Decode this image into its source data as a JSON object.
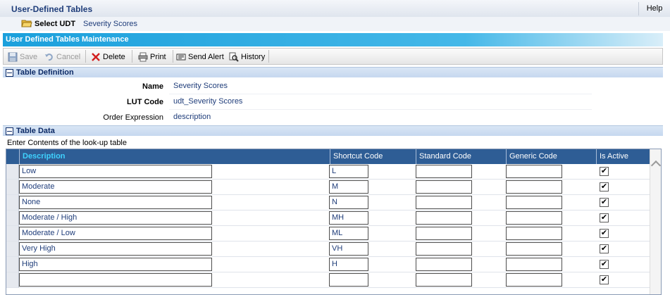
{
  "app": {
    "title": "User-Defined Tables",
    "help_label": "Help"
  },
  "udt": {
    "select_label": "Select UDT",
    "current": "Severity Scores"
  },
  "maintenance": {
    "title": "User Defined Tables Maintenance"
  },
  "toolbar": {
    "save": "Save",
    "cancel": "Cancel",
    "delete": "Delete",
    "print": "Print",
    "send_alert": "Send Alert",
    "history": "History"
  },
  "definition": {
    "section_title": "Table Definition",
    "name_label": "Name",
    "name_value": "Severity Scores",
    "lut_label": "LUT Code",
    "lut_value": "udt_Severity Scores",
    "order_label": "Order Expression",
    "order_value": "description"
  },
  "table_data": {
    "section_title": "Table Data",
    "hint": "Enter Contents of the look-up table",
    "columns": [
      "Description",
      "Shortcut Code",
      "Standard Code",
      "Generic Code",
      "Is Active"
    ],
    "rows": [
      {
        "description": "Low",
        "shortcut": "L",
        "standard": "",
        "generic": "",
        "active": true
      },
      {
        "description": "Moderate",
        "shortcut": "M",
        "standard": "",
        "generic": "",
        "active": true
      },
      {
        "description": "None",
        "shortcut": "N",
        "standard": "",
        "generic": "",
        "active": true
      },
      {
        "description": "Moderate / High",
        "shortcut": "MH",
        "standard": "",
        "generic": "",
        "active": true
      },
      {
        "description": "Moderate / Low",
        "shortcut": "ML",
        "standard": "",
        "generic": "",
        "active": true
      },
      {
        "description": "Very High",
        "shortcut": "VH",
        "standard": "",
        "generic": "",
        "active": true
      },
      {
        "description": "High",
        "shortcut": "H",
        "standard": "",
        "generic": "",
        "active": true
      },
      {
        "description": "",
        "shortcut": "",
        "standard": "",
        "generic": "",
        "active": true
      }
    ]
  }
}
